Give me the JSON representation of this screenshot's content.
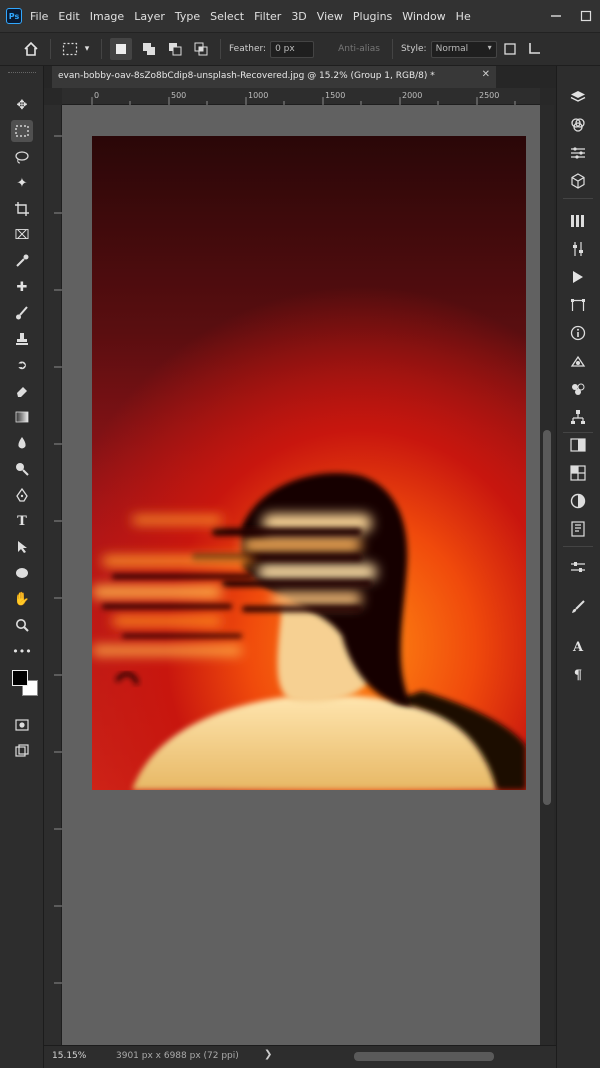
{
  "app": {
    "logo": "Ps"
  },
  "menu": [
    "File",
    "Edit",
    "Image",
    "Layer",
    "Type",
    "Select",
    "Filter",
    "3D",
    "View",
    "Plugins",
    "Window",
    "He"
  ],
  "options": {
    "feather_label": "Feather:",
    "feather_value": "0 px",
    "anti_alias_label": "Anti-alias",
    "style_label": "Style:",
    "style_value": "Normal"
  },
  "document": {
    "tab_title": "evan-bobby-oav-8sZo8bCdip8-unsplash-Recovered.jpg @ 15.2% (Group 1, RGB/8) *"
  },
  "ruler": {
    "h_labels": [
      "0",
      "500",
      "1000",
      "1500",
      "2000",
      "2500"
    ]
  },
  "status": {
    "zoom": "15.15%",
    "doc_info": "3901 px x 6988 px (72 ppi)"
  },
  "icons": {
    "left_tools": [
      "move-icon",
      "marquee-icon",
      "lasso-icon",
      "object-select-icon",
      "crop-icon",
      "frame-icon",
      "eyedropper-icon",
      "healing-brush-icon",
      "brush-icon",
      "clone-stamp-icon",
      "history-brush-icon",
      "eraser-icon",
      "gradient-icon",
      "blur-icon",
      "dodge-icon",
      "pen-icon",
      "type-icon",
      "path-select-icon",
      "ellipse-icon",
      "hand-icon",
      "zoom-icon",
      "more-tools-icon"
    ],
    "right_panels": [
      "layers-icon",
      "channels-icon",
      "paths-icon",
      "3d-icon",
      "libraries-icon",
      "adjustments-icon",
      "actions-icon",
      "paragraph-icon",
      "info-icon",
      "history-icon",
      "properties-icon",
      "swatches-icon",
      "color-icon",
      "styles-icon",
      "navigator-icon",
      "masks-icon",
      "timeline-icon",
      "brushes-icon",
      "character-icon",
      "paragraph-style-icon"
    ]
  },
  "colors": {
    "accent": "#31a8ff",
    "canvas_bg": "#616161",
    "ui_bg": "#2d2d2d"
  }
}
